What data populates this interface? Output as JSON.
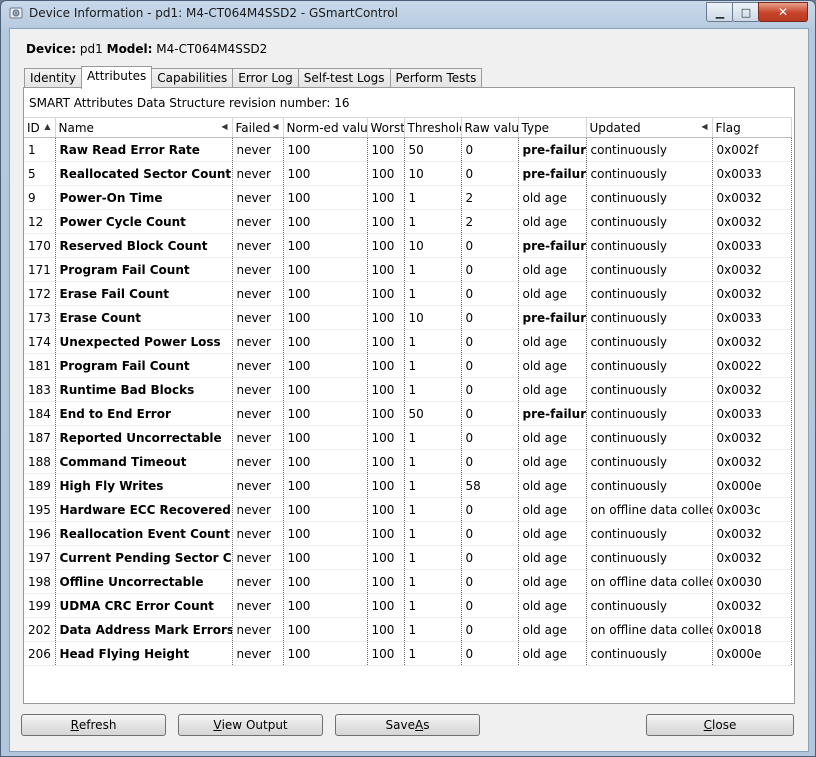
{
  "window": {
    "title": "Device Information - pd1: M4-CT064M4SSD2 - GSmartControl",
    "controls": {
      "minimize": "▁",
      "maximize": "□",
      "close": "✕"
    }
  },
  "device": {
    "device_label": "Device:",
    "device_value": "pd1",
    "model_label": "Model:",
    "model_value": "M4-CT064M4SSD2"
  },
  "tabs": [
    {
      "label": "Identity",
      "active": false
    },
    {
      "label": "Attributes",
      "active": true
    },
    {
      "label": "Capabilities",
      "active": false
    },
    {
      "label": "Error Log",
      "active": false
    },
    {
      "label": "Self-test Logs",
      "active": false
    },
    {
      "label": "Perform Tests",
      "active": false
    }
  ],
  "attributes": {
    "revision_text": "SMART Attributes Data Structure revision number: 16",
    "columns": [
      {
        "key": "id",
        "label": "ID",
        "sort": "▲"
      },
      {
        "key": "name",
        "label": "Name",
        "sort": "◀"
      },
      {
        "key": "failed",
        "label": "Failed",
        "sort": "◀"
      },
      {
        "key": "normed",
        "label": "Norm-ed value",
        "sort": ""
      },
      {
        "key": "worst",
        "label": "Worst",
        "sort": ""
      },
      {
        "key": "threshold",
        "label": "Threshold",
        "sort": ""
      },
      {
        "key": "raw",
        "label": "Raw value",
        "sort": ""
      },
      {
        "key": "type",
        "label": "Type",
        "sort": ""
      },
      {
        "key": "updated",
        "label": "Updated",
        "sort": "◀"
      },
      {
        "key": "flag",
        "label": "Flag",
        "sort": ""
      }
    ],
    "rows": [
      [
        "1",
        "Raw Read Error Rate",
        "never",
        "100",
        "100",
        "50",
        "0",
        "pre-failure",
        "continuously",
        "0x002f"
      ],
      [
        "5",
        "Reallocated Sector Count",
        "never",
        "100",
        "100",
        "10",
        "0",
        "pre-failure",
        "continuously",
        "0x0033"
      ],
      [
        "9",
        "Power-On Time",
        "never",
        "100",
        "100",
        "1",
        "2",
        "old age",
        "continuously",
        "0x0032"
      ],
      [
        "12",
        "Power Cycle Count",
        "never",
        "100",
        "100",
        "1",
        "2",
        "old age",
        "continuously",
        "0x0032"
      ],
      [
        "170",
        "Reserved Block Count",
        "never",
        "100",
        "100",
        "10",
        "0",
        "pre-failure",
        "continuously",
        "0x0033"
      ],
      [
        "171",
        "Program Fail Count",
        "never",
        "100",
        "100",
        "1",
        "0",
        "old age",
        "continuously",
        "0x0032"
      ],
      [
        "172",
        "Erase Fail Count",
        "never",
        "100",
        "100",
        "1",
        "0",
        "old age",
        "continuously",
        "0x0032"
      ],
      [
        "173",
        "Erase Count",
        "never",
        "100",
        "100",
        "10",
        "0",
        "pre-failure",
        "continuously",
        "0x0033"
      ],
      [
        "174",
        "Unexpected Power Loss",
        "never",
        "100",
        "100",
        "1",
        "0",
        "old age",
        "continuously",
        "0x0032"
      ],
      [
        "181",
        "Program Fail Count",
        "never",
        "100",
        "100",
        "1",
        "0",
        "old age",
        "continuously",
        "0x0022"
      ],
      [
        "183",
        "Runtime Bad Blocks",
        "never",
        "100",
        "100",
        "1",
        "0",
        "old age",
        "continuously",
        "0x0032"
      ],
      [
        "184",
        "End to End Error",
        "never",
        "100",
        "100",
        "50",
        "0",
        "pre-failure",
        "continuously",
        "0x0033"
      ],
      [
        "187",
        "Reported Uncorrectable",
        "never",
        "100",
        "100",
        "1",
        "0",
        "old age",
        "continuously",
        "0x0032"
      ],
      [
        "188",
        "Command Timeout",
        "never",
        "100",
        "100",
        "1",
        "0",
        "old age",
        "continuously",
        "0x0032"
      ],
      [
        "189",
        "High Fly Writes",
        "never",
        "100",
        "100",
        "1",
        "58",
        "old age",
        "continuously",
        "0x000e"
      ],
      [
        "195",
        "Hardware ECC Recovered",
        "never",
        "100",
        "100",
        "1",
        "0",
        "old age",
        "on offline data collect.",
        "0x003c"
      ],
      [
        "196",
        "Reallocation Event Count",
        "never",
        "100",
        "100",
        "1",
        "0",
        "old age",
        "continuously",
        "0x0032"
      ],
      [
        "197",
        "Current Pending Sector Count",
        "never",
        "100",
        "100",
        "1",
        "0",
        "old age",
        "continuously",
        "0x0032"
      ],
      [
        "198",
        "Offline Uncorrectable",
        "never",
        "100",
        "100",
        "1",
        "0",
        "old age",
        "on offline data collect.",
        "0x0030"
      ],
      [
        "199",
        "UDMA CRC Error Count",
        "never",
        "100",
        "100",
        "1",
        "0",
        "old age",
        "continuously",
        "0x0032"
      ],
      [
        "202",
        "Data Address Mark Errors",
        "never",
        "100",
        "100",
        "1",
        "0",
        "old age",
        "on offline data collect.",
        "0x0018"
      ],
      [
        "206",
        "Head Flying Height",
        "never",
        "100",
        "100",
        "1",
        "0",
        "old age",
        "continuously",
        "0x000e"
      ]
    ]
  },
  "buttons": {
    "refresh": {
      "pre": "",
      "key": "R",
      "post": "efresh"
    },
    "view_output": {
      "pre": "",
      "key": "V",
      "post": "iew Output"
    },
    "save_as": {
      "pre": "Save ",
      "key": "A",
      "post": "s"
    },
    "close": {
      "pre": "",
      "key": "C",
      "post": "lose"
    }
  },
  "colors": {
    "accent": "#b5c9de",
    "close_button": "#c7432a"
  }
}
